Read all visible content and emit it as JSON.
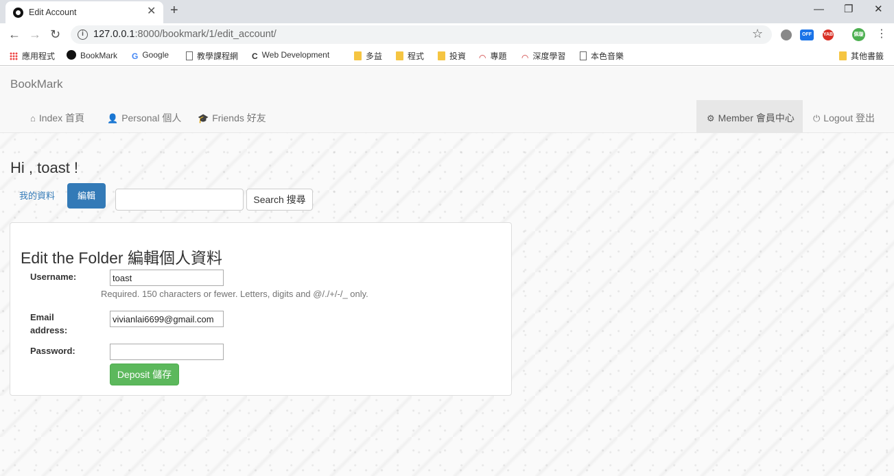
{
  "browser": {
    "tab_title": "Edit Account",
    "tab_close": "✕",
    "new_tab": "+",
    "window_controls": {
      "minimize": "—",
      "restore": "❐",
      "close": "✕"
    },
    "url_host": "127.0.0.1",
    "url_rest": ":8000/bookmark/1/edit_account/",
    "extensions": [
      {
        "name": "gray-circle-icon",
        "label": "",
        "color": "#888888"
      },
      {
        "name": "off-badge-icon",
        "label": "OFF",
        "color": "#1a73e8"
      },
      {
        "name": "yab-icon",
        "label": "YAB",
        "color": "#d93025"
      },
      {
        "name": "profile-avatar-icon",
        "label": "佩璇",
        "color": "#4caf50"
      }
    ],
    "bookmarks": [
      {
        "label": "應用程式",
        "icon": "apps-icon"
      },
      {
        "label": "BookMark",
        "icon": "bookmark-site-icon"
      },
      {
        "label": "Google",
        "icon": "google-icon"
      },
      {
        "label": "教學課程網",
        "icon": "page-icon"
      },
      {
        "label": "Web Development",
        "icon": "site-icon"
      },
      {
        "label": "多益",
        "icon": "folder-icon"
      },
      {
        "label": "程式",
        "icon": "folder-icon"
      },
      {
        "label": "投資",
        "icon": "folder-icon"
      },
      {
        "label": "專題",
        "icon": "speed-icon"
      },
      {
        "label": "深度學習",
        "icon": "speed-icon"
      },
      {
        "label": "本色音樂",
        "icon": "page-icon"
      },
      {
        "label": "其他書籤",
        "icon": "folder-icon"
      }
    ]
  },
  "navbar": {
    "brand": "BookMark",
    "items": [
      {
        "label": "Index 首頁",
        "icon": "home-icon"
      },
      {
        "label": "Personal 個人",
        "icon": "user-icon"
      },
      {
        "label": "Friends 好友",
        "icon": "graduation-cap-icon"
      },
      {
        "label": "Member 會員中心",
        "icon": "gear-icon"
      },
      {
        "label": "Logout 登出",
        "icon": "power-icon"
      }
    ]
  },
  "greeting": "Hi , toast !",
  "pills": {
    "profile": "我的資料",
    "edit": "編輯"
  },
  "search": {
    "value": "",
    "button": "Search 搜尋"
  },
  "form": {
    "title": "Edit the Folder 編輯個人資料",
    "username_label": "Username:",
    "username_value": "toast",
    "username_help": "Required. 150 characters or fewer. Letters, digits and @/./+/-/_ only.",
    "email_label_line1": "Email",
    "email_label_line2": "address:",
    "email_value": "vivianlai6699@gmail.com",
    "password_label": "Password:",
    "password_value": "",
    "save_button": "Deposit 儲存"
  },
  "colors": {
    "primary": "#337ab7",
    "success": "#5cb85c",
    "navbar_bg": "#f8f8f8"
  }
}
